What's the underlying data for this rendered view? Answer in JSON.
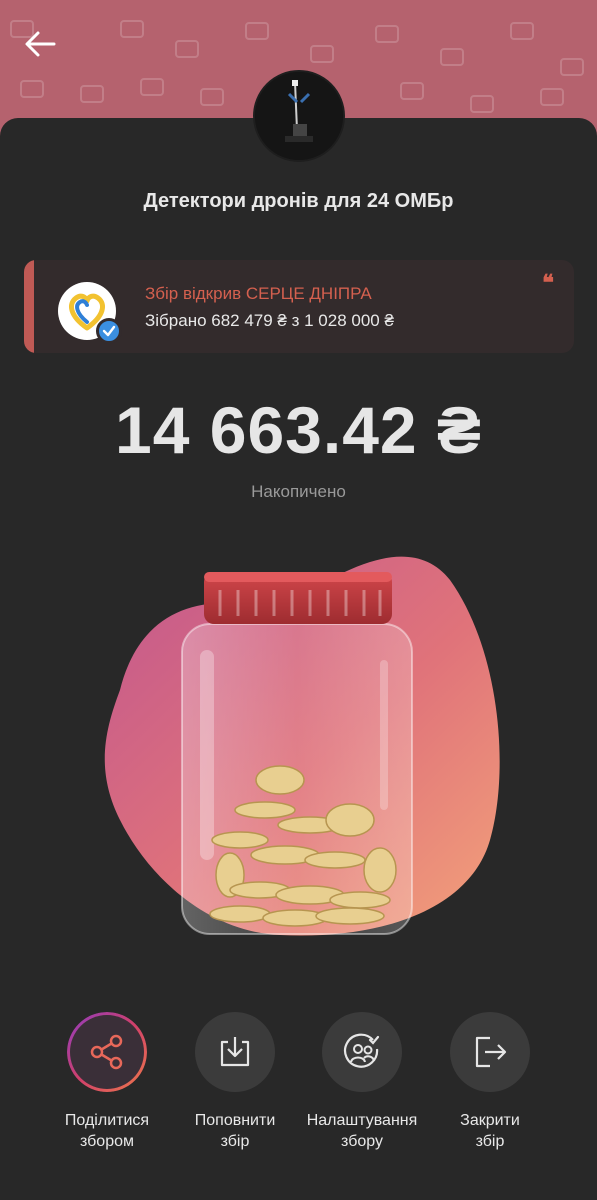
{
  "header": {
    "back_label": "←"
  },
  "campaign": {
    "title": "Детектори дронів для 24 ОМБр",
    "organizer_name": "Збір відкрив СЕРЦЕ ДНІПРА",
    "organizer_collected": "Зібрано 682 479 ₴ з 1 028 000 ₴",
    "quote_mark": "❝"
  },
  "balance": {
    "amount": "14 663.42 ₴",
    "label": "Накопичено"
  },
  "actions": [
    {
      "label_line1": "Поділитися",
      "label_line2": "збором",
      "icon": "share-icon"
    },
    {
      "label_line1": "Поповнити",
      "label_line2": "збір",
      "icon": "download-tray-icon"
    },
    {
      "label_line1": "Налаштування",
      "label_line2": "збору",
      "icon": "users-settings-icon"
    },
    {
      "label_line1": "Закрити",
      "label_line2": "збір",
      "icon": "exit-icon"
    }
  ],
  "colors": {
    "band": "#b5626e",
    "background": "#282828",
    "accent": "#d4604f",
    "verified": "#3b8fe0"
  }
}
